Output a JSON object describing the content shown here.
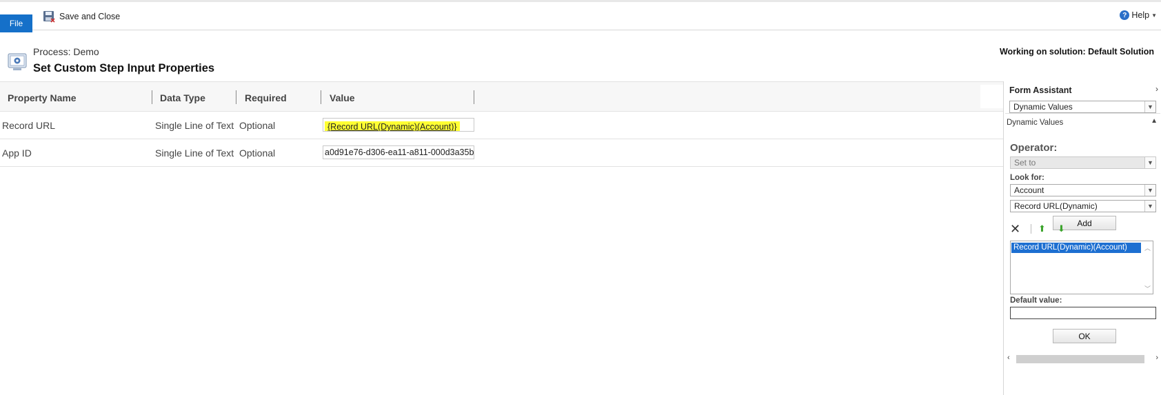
{
  "ribbon": {
    "file_label": "File",
    "save_close_label": "Save and Close",
    "help_label": "Help"
  },
  "header": {
    "process_label": "Process: Demo",
    "title": "Set Custom Step Input Properties",
    "solution_label": "Working on solution: Default Solution"
  },
  "grid": {
    "columns": [
      "Property Name",
      "Data Type",
      "Required",
      "Value"
    ],
    "rows": [
      {
        "name": "Record URL",
        "type": "Single Line of Text",
        "required": "Optional",
        "value": "{Record URL(Dynamic)(Account)}"
      },
      {
        "name": "App ID",
        "type": "Single Line of Text",
        "required": "Optional",
        "value": "a0d91e76-d306-ea11-a811-000d3a35b"
      }
    ]
  },
  "assistant": {
    "title": "Form Assistant",
    "source_select": "Dynamic Values",
    "section_label": "Dynamic Values",
    "operator_label": "Operator:",
    "operator_value": "Set to",
    "look_for_label": "Look for:",
    "entity_select": "Account",
    "field_select": "Record URL(Dynamic)",
    "add_label": "Add",
    "list_items": [
      "Record URL(Dynamic)(Account)"
    ],
    "default_value_label": "Default value:",
    "ok_label": "OK"
  },
  "colors": {
    "accent": "#1570c9",
    "highlight": "#ffff33",
    "selection": "#1d6fd1",
    "arrow_green": "#3aa32b"
  }
}
